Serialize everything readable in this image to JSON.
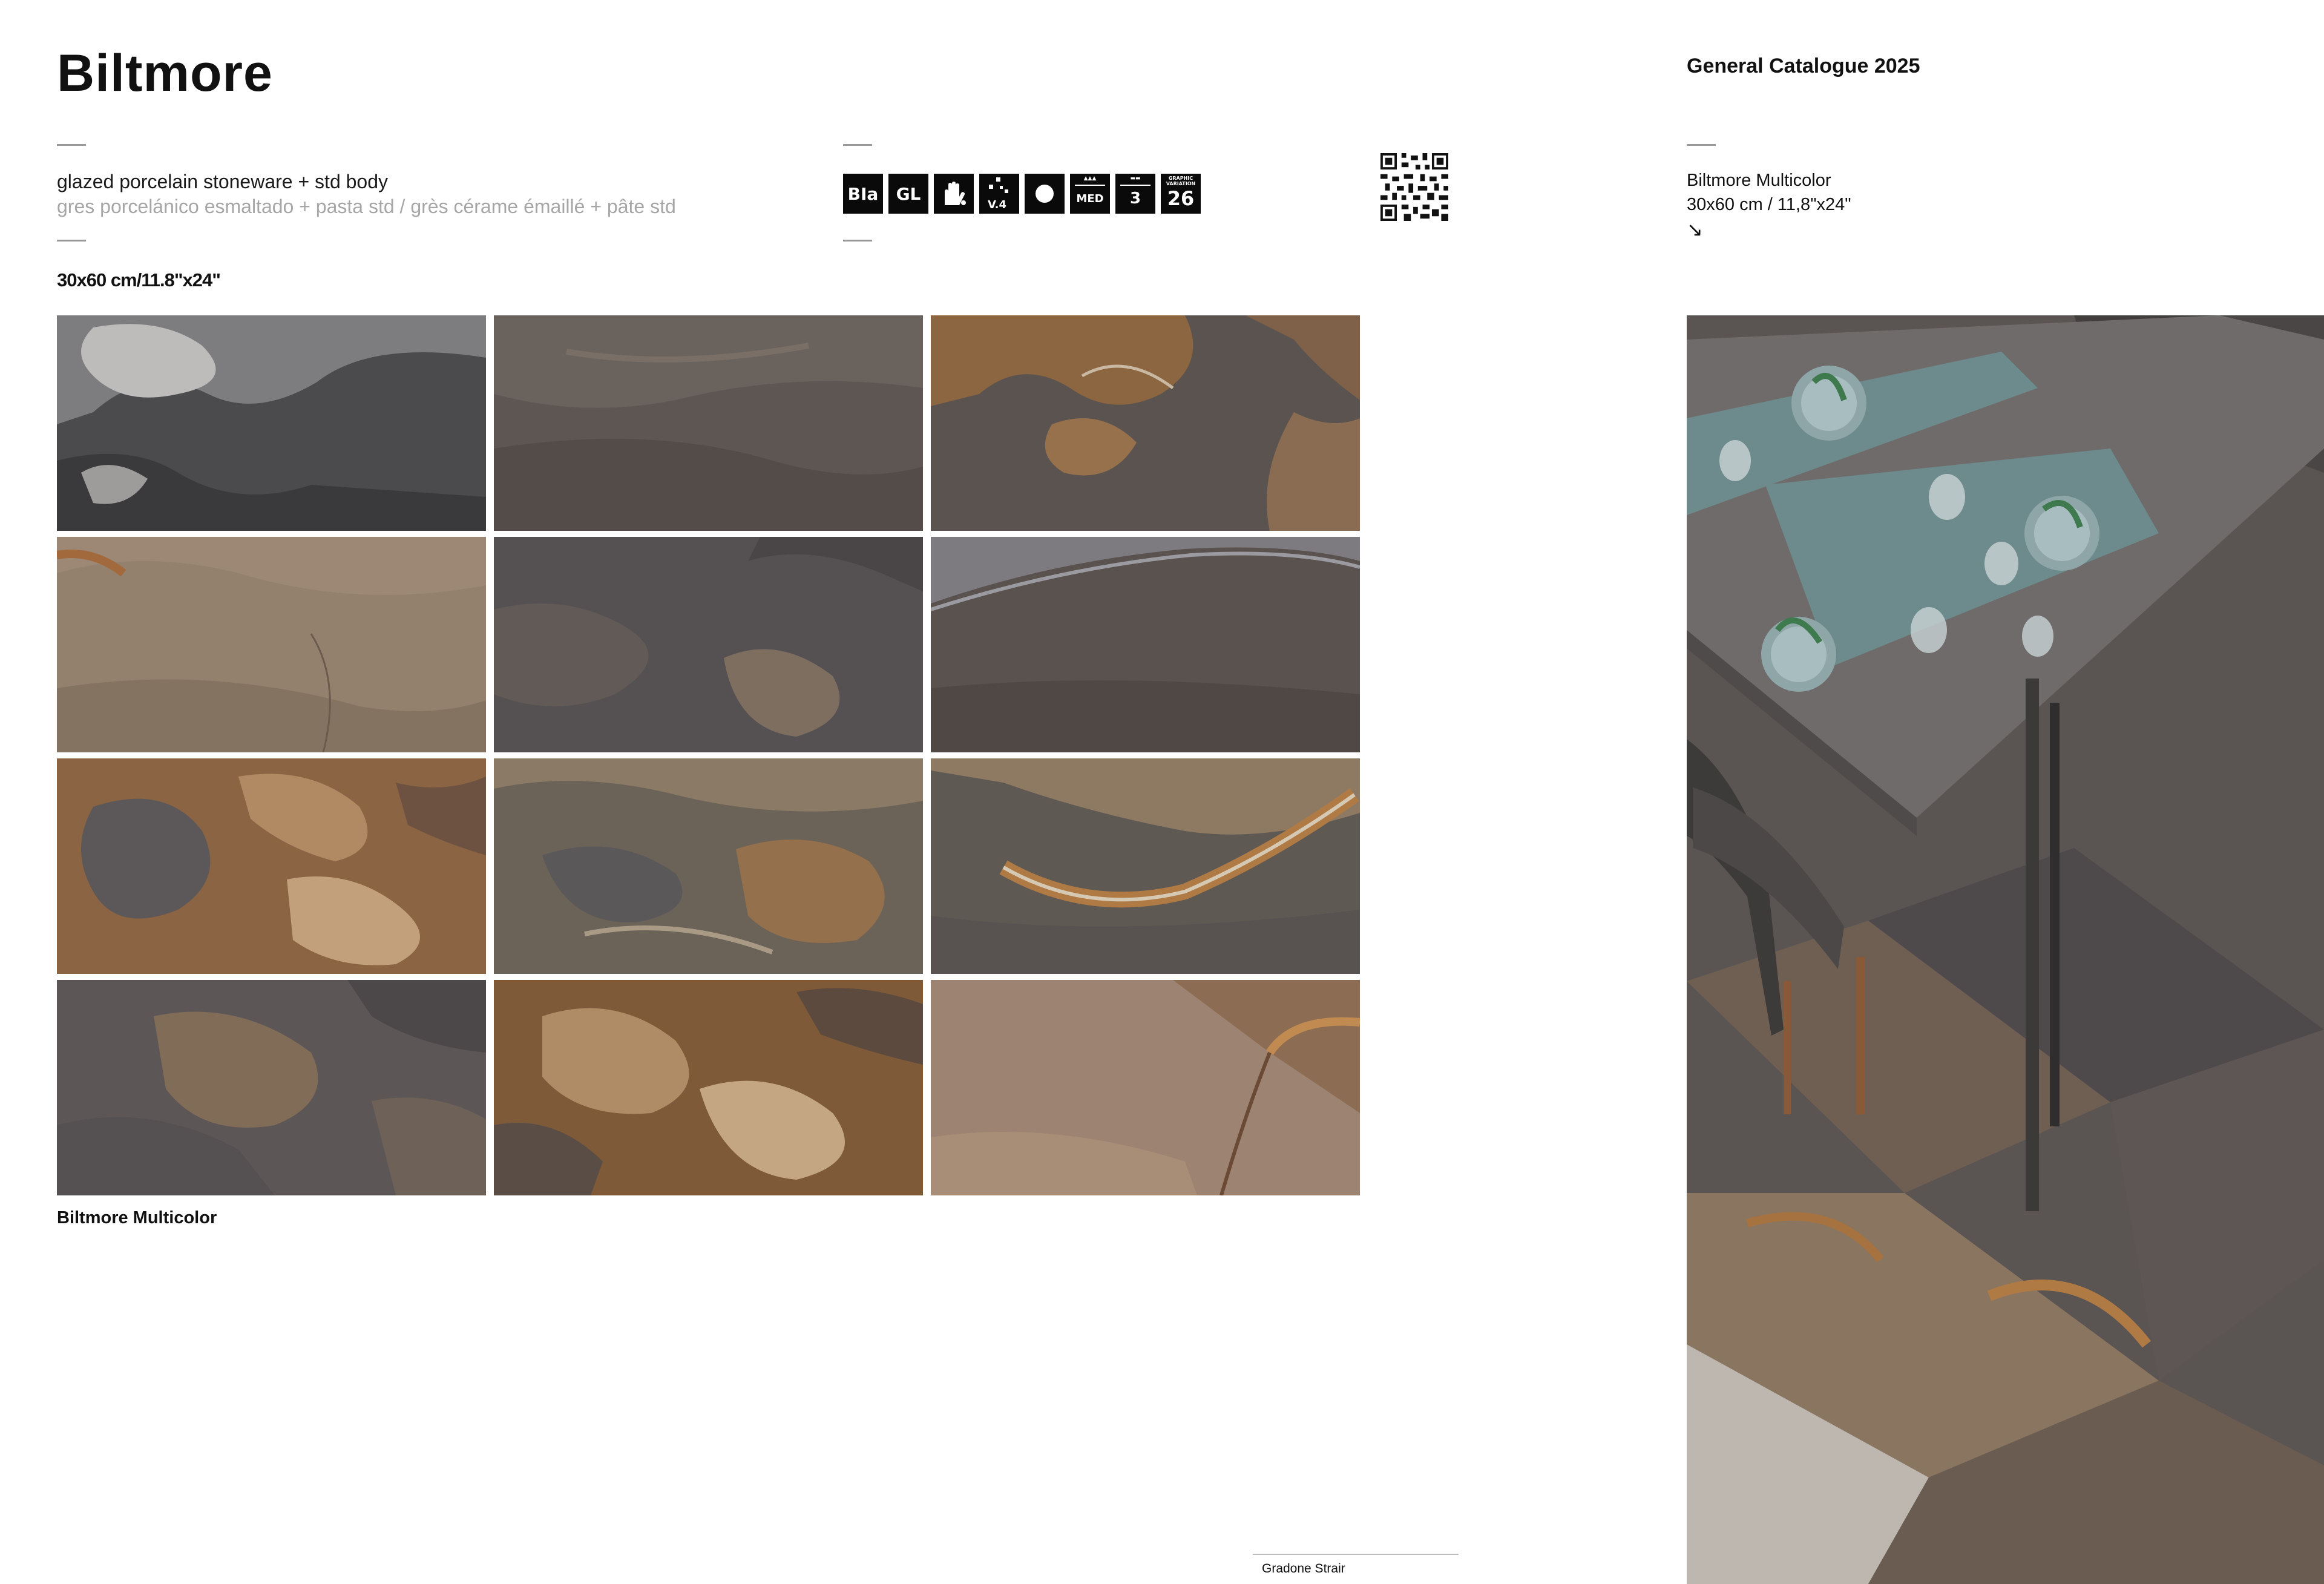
{
  "header": {
    "title": "Biltmore",
    "catalogue": "General Catalogue 2025"
  },
  "description": {
    "line1": "glazed porcelain stoneware + std body",
    "line2": "gres porcelánico esmaltado + pasta std / grès cérame émaillé + pâte std",
    "size": "30x60 cm/11.8\"x24\""
  },
  "icons": [
    {
      "name": "water-absorption-icon",
      "label": "BIa"
    },
    {
      "name": "glazed-icon",
      "label": "GL"
    },
    {
      "name": "stain-resistance-icon",
      "label": ""
    },
    {
      "name": "shade-variation-icon",
      "label": "V.4"
    },
    {
      "name": "finish-icon",
      "label": ""
    },
    {
      "name": "traffic-icon",
      "label": "MED"
    },
    {
      "name": "abrasion-class-icon",
      "label": "3"
    },
    {
      "name": "graphic-variation-icon",
      "top": "GRAPHIC VARIATION",
      "label": "26"
    }
  ],
  "product": {
    "name": "Biltmore Multicolor",
    "size": "30x60 cm / 11,8\"x24\"",
    "arrow": "↘"
  },
  "caption": "Biltmore Multicolor",
  "footer_note": "Gradone Strair",
  "colors": {
    "text": "#111111",
    "muted": "#a6a6a6",
    "rule": "#9a9a9a",
    "icon_bg": "#0a0a0a"
  }
}
